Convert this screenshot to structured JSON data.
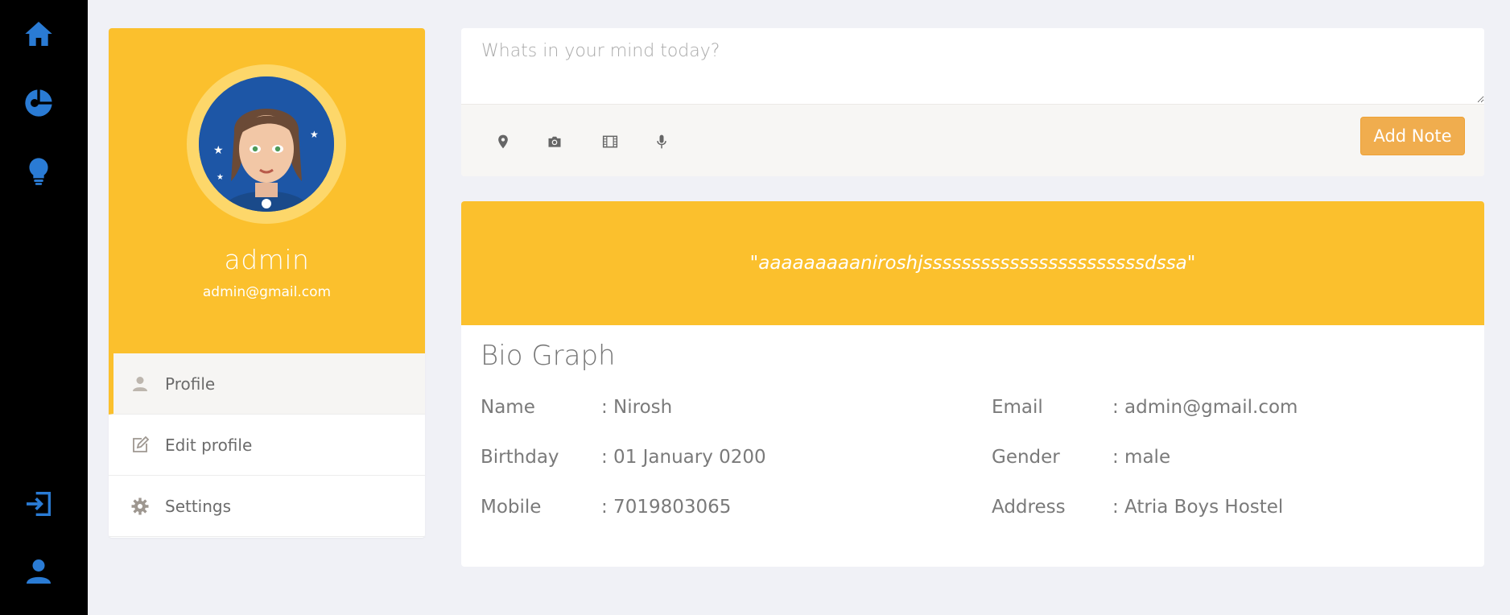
{
  "sidebar_rail": {
    "icons": [
      "home-icon",
      "pie-chart-icon",
      "lightbulb-icon",
      "sign-in-icon",
      "user-icon"
    ],
    "icon_color": "#2a7bd4",
    "background": "#000000"
  },
  "profile": {
    "name": "admin",
    "email": "admin@gmail.com",
    "header_color": "#fbc02d",
    "menu": [
      {
        "label": "Profile",
        "icon": "user-icon",
        "active": true
      },
      {
        "label": "Edit profile",
        "icon": "edit-icon",
        "active": false
      },
      {
        "label": "Settings",
        "icon": "gear-icon",
        "active": false
      }
    ]
  },
  "note": {
    "placeholder": "Whats in your mind today?",
    "tools": [
      "map-marker-icon",
      "camera-icon",
      "film-icon",
      "microphone-icon"
    ],
    "add_label": "Add Note",
    "button_color": "#f0ad4e"
  },
  "bio": {
    "quote": "\"aaaaaaaaaniroshjsssssssssssssssssssssssdssa\"",
    "title": "Bio Graph",
    "fields": [
      {
        "label": "Name",
        "value": ": Nirosh"
      },
      {
        "label": "Email",
        "value": ": admin@gmail.com"
      },
      {
        "label": "Birthday",
        "value": ": 01 January 0200"
      },
      {
        "label": "Gender",
        "value": ": male"
      },
      {
        "label": "Mobile",
        "value": ": 7019803065"
      },
      {
        "label": "Address",
        "value": ": Atria Boys Hostel"
      }
    ]
  }
}
